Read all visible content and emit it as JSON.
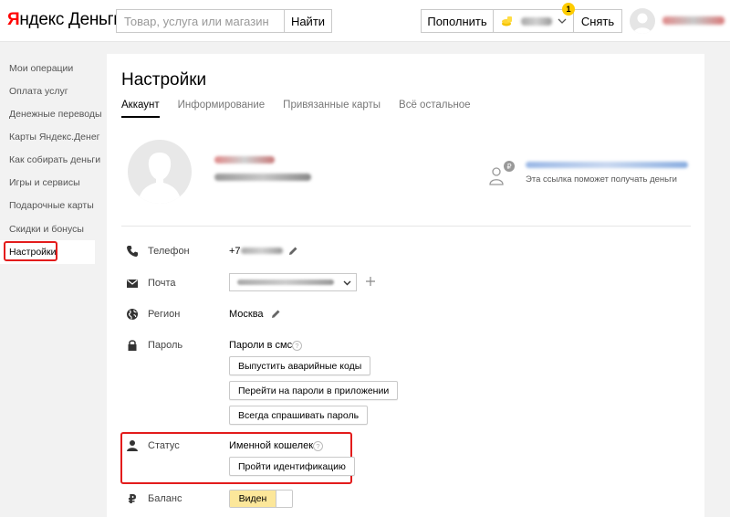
{
  "header": {
    "logo_accent": "Я",
    "logo_rest": "ндекс Деньги",
    "search_placeholder": "Товар, услуга или магазин",
    "search_button": "Найти",
    "topup_label": "Пополнить",
    "notification_count": "1",
    "withdraw_label": "Снять"
  },
  "sidebar": {
    "items": [
      {
        "label": "Мои операции"
      },
      {
        "label": "Оплата услуг"
      },
      {
        "label": "Денежные переводы"
      },
      {
        "label": "Карты Яндекс.Денег"
      },
      {
        "label": "Как собирать деньги"
      },
      {
        "label": "Игры и сервисы"
      },
      {
        "label": "Подарочные карты"
      },
      {
        "label": "Скидки и бонусы"
      },
      {
        "label": "Настройки"
      }
    ],
    "active_index": 8
  },
  "page": {
    "title": "Настройки",
    "tabs": [
      {
        "label": "Аккаунт",
        "active": true
      },
      {
        "label": "Информирование",
        "active": false
      },
      {
        "label": "Привязанные карты",
        "active": false
      },
      {
        "label": "Всё остальное",
        "active": false
      }
    ]
  },
  "profile": {
    "link_hint": "Эта ссылка поможет получать деньги"
  },
  "rows": {
    "phone": {
      "label": "Телефон",
      "value_prefix": "+7"
    },
    "email": {
      "label": "Почта"
    },
    "region": {
      "label": "Регион",
      "value": "Москва"
    },
    "password": {
      "label": "Пароль",
      "value": "Пароли в смс",
      "buttons": [
        {
          "label": "Выпустить аварийные коды"
        },
        {
          "label": "Перейти на пароли в приложении"
        },
        {
          "label": "Всегда спрашивать пароль"
        }
      ]
    },
    "status": {
      "label": "Статус",
      "value": "Именной кошелек",
      "button": "Пройти идентификацию"
    },
    "balance": {
      "label": "Баланс",
      "toggle_label": "Виден",
      "visible": true
    }
  },
  "help_glyph": "?",
  "colors": {
    "brand_red": "#ff0000",
    "highlight_red": "#e31c1c",
    "toggle_yellow": "#fce79a",
    "badge_yellow": "#ffcc00"
  }
}
